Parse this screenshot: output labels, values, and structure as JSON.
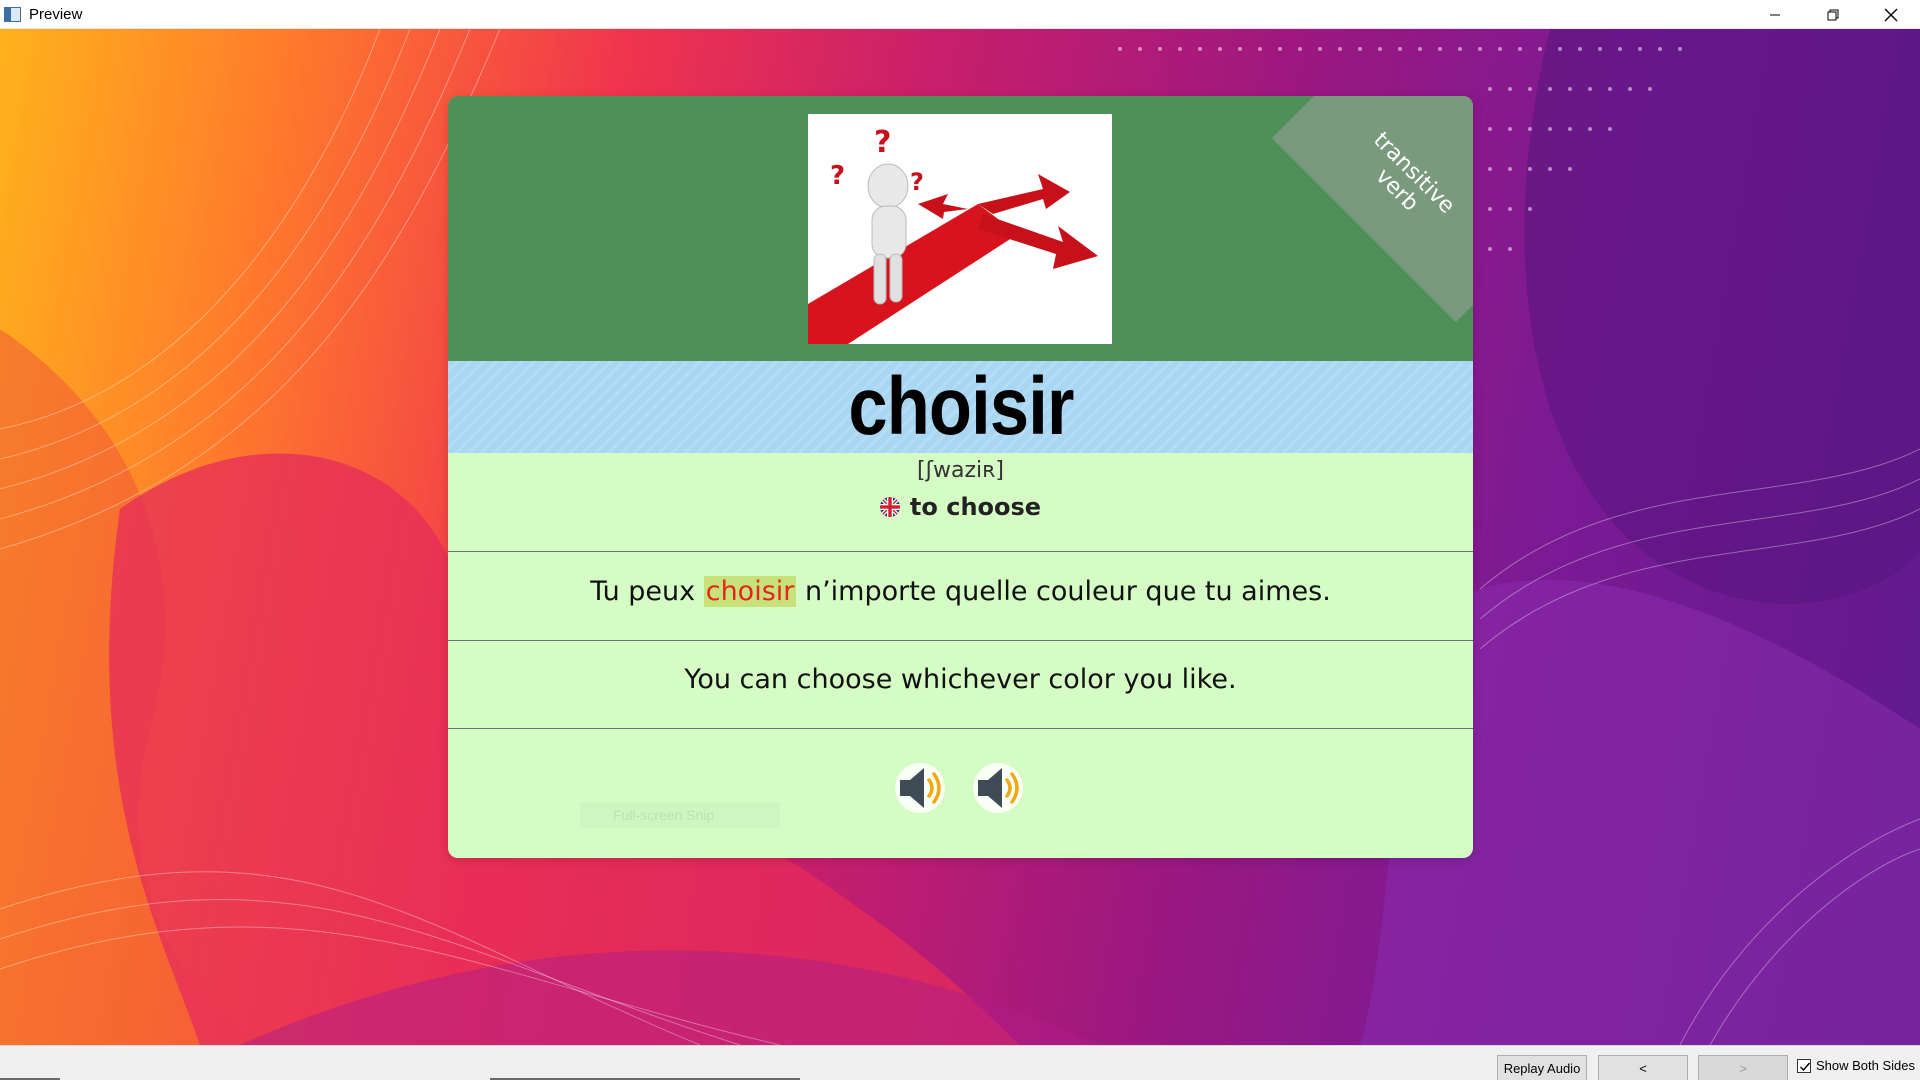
{
  "window": {
    "title": "Preview",
    "controls": [
      "minimize-icon",
      "restore-icon",
      "close-icon"
    ]
  },
  "card": {
    "word_type": "transitive verb",
    "word": "choisir",
    "pronunciation": "[ʃwaziʀ]",
    "translation": "to choose",
    "translation_flag": "uk-flag-icon",
    "sentence_fr": {
      "before": "Tu peux ",
      "highlight": "choisir",
      "after": " n’importe quelle couleur que tu aimes."
    },
    "sentence_en": "You can choose whichever color you like.",
    "audio_buttons": [
      "speaker-icon",
      "speaker-icon"
    ],
    "snip_hint": "Full-screen Snip",
    "colors": {
      "top_band": "#4e9057",
      "word_band": "#a9d6f2",
      "body": "#d5fcc4",
      "highlight_text": "#e3261e",
      "highlight_bg": "#c8e27a"
    }
  },
  "bottom_bar": {
    "replay_audio": "Replay Audio",
    "prev": "<",
    "next": ">",
    "show_both_sides": "Show Both Sides",
    "show_both_sides_checked": true
  }
}
